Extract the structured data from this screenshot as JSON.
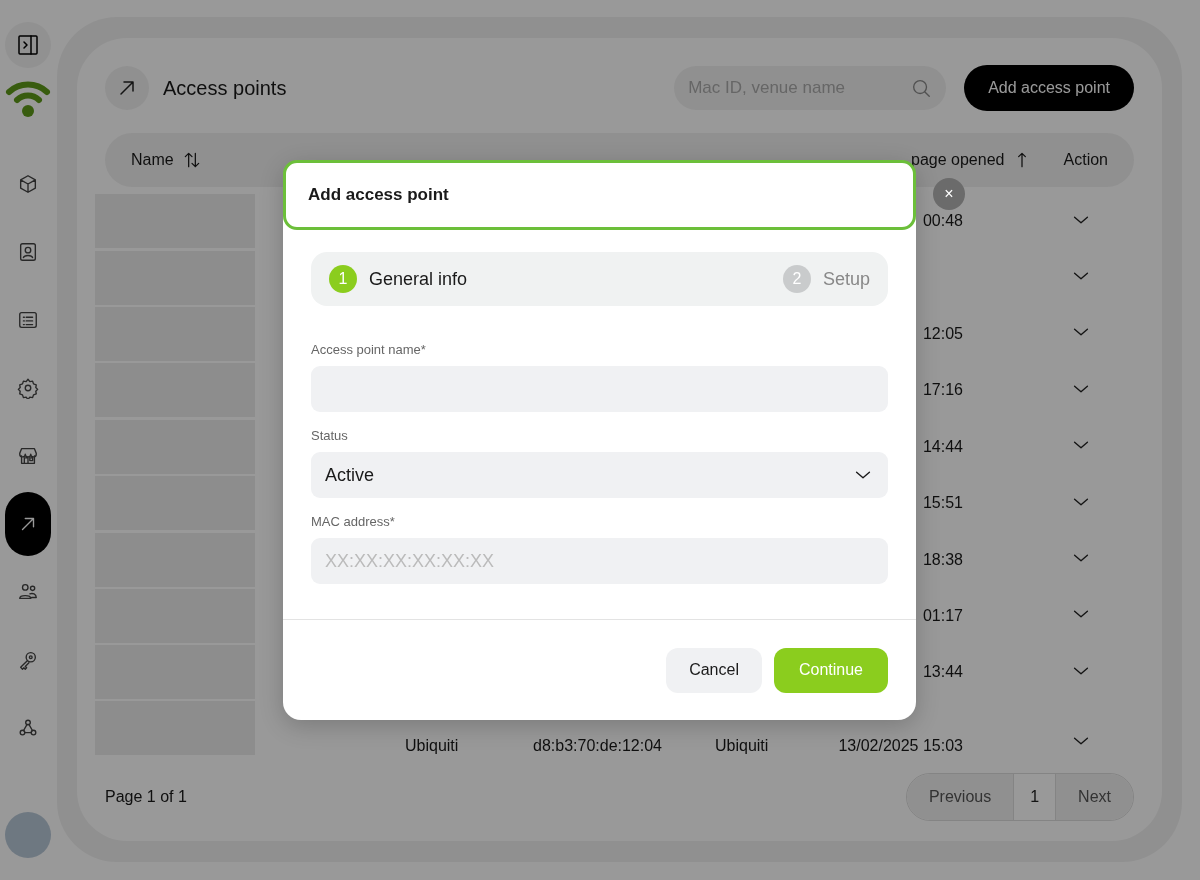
{
  "sidebar": {
    "items": [
      {
        "selected": false
      },
      {
        "selected": false
      },
      {
        "selected": false
      },
      {
        "selected": false
      },
      {
        "selected": false
      },
      {
        "selected": true
      },
      {
        "selected": false
      },
      {
        "selected": false
      },
      {
        "selected": false
      }
    ]
  },
  "page": {
    "title": "Access points",
    "search": {
      "placeholder": "Mac ID, venue name"
    },
    "add_button": "Add access point"
  },
  "table": {
    "columns": [
      {
        "label": "Name"
      },
      {
        "label": "page opened"
      },
      {
        "label": "Action"
      }
    ],
    "rows": [
      {
        "time": "00:48"
      },
      {},
      {
        "time": "12:05"
      },
      {
        "time": "17:16"
      },
      {
        "time": "14:44"
      },
      {
        "time": "15:51"
      },
      {
        "time": "18:38"
      },
      {
        "time": "01:17"
      },
      {
        "time": "13:44"
      },
      {
        "vendor": "Ubiquiti",
        "mac": "d8:b3:70:de:12:04",
        "type": "Ubiquiti",
        "time": "13/02/2025 15:03"
      }
    ]
  },
  "pagination": {
    "summary": "Page 1 of 1",
    "previous": {
      "label": "Previous",
      "disabled": true
    },
    "page": "1",
    "next": {
      "label": "Next",
      "disabled": true
    }
  },
  "dialog": {
    "title": "Add access point",
    "close": "×",
    "steps": [
      {
        "number": "1",
        "label": "General info",
        "selected": true
      },
      {
        "number": "2",
        "label": "Setup",
        "selected": false
      }
    ],
    "fields": [
      {
        "kind": "text",
        "label": "Access point name*"
      },
      {
        "kind": "select",
        "label": "Status",
        "value": "Active"
      },
      {
        "kind": "text",
        "label": "MAC address*",
        "placeholder": "XX:XX:XX:XX:XX:XX"
      }
    ],
    "buttons": [
      {
        "label": "Cancel",
        "kind": "secondary"
      },
      {
        "label": "Continue",
        "kind": "primary"
      }
    ]
  }
}
